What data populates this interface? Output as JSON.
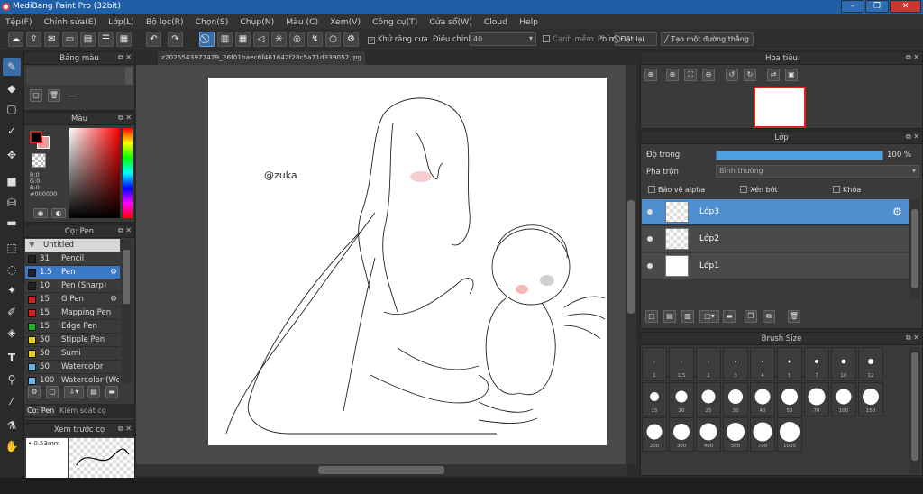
{
  "app": {
    "title": "MediBang Paint Pro (32bit)"
  },
  "menu": [
    "Tệp(F)",
    "Chỉnh sửa(E)",
    "Lớp(L)",
    "Bộ lọc(R)",
    "Chọn(S)",
    "Chụp(N)",
    "Màu (C)",
    "Xem(V)",
    "Công cụ(T)",
    "Cửa sổ(W)",
    "Cloud",
    "Help"
  ],
  "toolbar": {
    "antialias_label": "Khử răng cưa",
    "adjust_label": "Điều chỉnh",
    "adjust_value": "40",
    "edge_label": "Cạnh mềm",
    "hotkey_label": "Phím",
    "reset_label": "Đặt lại",
    "straight_label": "Tạo một đường thẳng"
  },
  "palette_panel": {
    "title": "Bảng màu",
    "empty_text": "---"
  },
  "color_panel": {
    "title": "Màu",
    "r": "R:0",
    "g": "G:0",
    "b": "B:0",
    "hex": "#000000",
    "main_color": "#000000",
    "sub_color": "#e8a0a0"
  },
  "brush_panel": {
    "title": "Cọ: Pen",
    "group": "Untitled",
    "items": [
      {
        "size": "31",
        "name": "Pencil",
        "color": "#222222"
      },
      {
        "size": "1.5",
        "name": "Pen",
        "color": "#222222"
      },
      {
        "size": "10",
        "name": "Pen (Sharp)",
        "color": "#222222"
      },
      {
        "size": "15",
        "name": "G Pen",
        "color": "#d42020"
      },
      {
        "size": "15",
        "name": "Mapping Pen",
        "color": "#d42020"
      },
      {
        "size": "15",
        "name": "Edge Pen",
        "color": "#20b020"
      },
      {
        "size": "50",
        "name": "Stipple Pen",
        "color": "#e8d020"
      },
      {
        "size": "50",
        "name": "Sumi",
        "color": "#e8d020"
      },
      {
        "size": "50",
        "name": "Watercolor",
        "color": "#6ab4e8"
      },
      {
        "size": "100",
        "name": "Watercolor (We",
        "color": "#6ab4e8"
      }
    ],
    "tabs": [
      "Cọ: Pen",
      "Kiểm soát cọ"
    ]
  },
  "preview_panel": {
    "title": "Xem trước cọ",
    "size": "0.53mm"
  },
  "document": {
    "tab": "z2025543977479_26f01baec6f461642f28c5a71d339052.jpg",
    "signature": "@zuka"
  },
  "navigator": {
    "title": "Hoa tiêu"
  },
  "layer_panel": {
    "title": "Lớp",
    "opacity_label": "Độ trong",
    "opacity_value": "100 %",
    "opacity_fraction": 1.0,
    "blend_label": "Pha trộn",
    "blend_value": "Bình thường",
    "protect_alpha": "Bảo vệ alpha",
    "clipping": "Xén bớt",
    "lock": "Khóa",
    "layers": [
      {
        "name": "Lớp3",
        "selected": true
      },
      {
        "name": "Lớp2",
        "selected": false
      },
      {
        "name": "Lớp1",
        "selected": false
      }
    ]
  },
  "brush_size_panel": {
    "title": "Brush Size",
    "sizes": [
      "1",
      "1.5",
      "2",
      "3",
      "4",
      "5",
      "7",
      "10",
      "12",
      "15",
      "20",
      "25",
      "30",
      "40",
      "50",
      "70",
      "100",
      "150",
      "200",
      "300",
      "400",
      "500",
      "700",
      "1000"
    ]
  }
}
